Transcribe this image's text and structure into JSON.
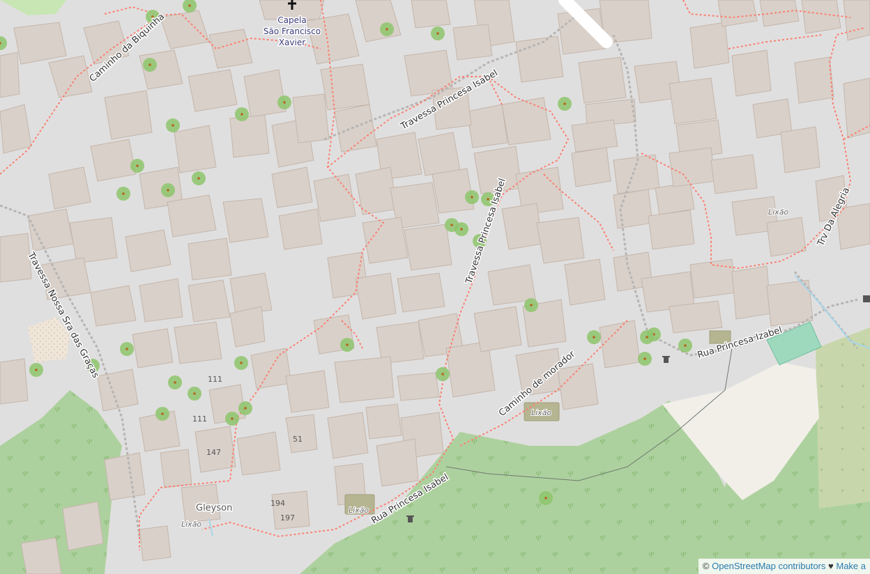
{
  "map": {
    "chapel": {
      "name_line1": "Capela",
      "name_line2": "São Francisco",
      "name_line3": "Xavier",
      "icon": "cross-icon"
    },
    "streets": {
      "caminho_biquinha": "Caminho da Biquinha",
      "travessa_princesa_isabel_top": "Travessa Princesa Isabel",
      "travessa_princesa_isabel_mid": "Travessa Princesa Isabel",
      "travessa_nossa_sra": "Travessa Nossa Sra das Graças",
      "caminho_morador": "Caminho de morador",
      "rua_princesa_isabel": "Rua Princesa Isabel",
      "rua_princesa_izabel": "Rua Princesa Izabel",
      "trv_da_alegria": "Trv Da Alegria"
    },
    "labels": {
      "lixao_1": "Lixão",
      "lixao_2": "Lixão",
      "lixao_3": "Lixão",
      "lixao_4": "Lixão",
      "gleyson": "Gleyson"
    },
    "house_numbers": {
      "n111a": "111",
      "n111b": "111",
      "n147": "147",
      "n51": "51",
      "n194": "194",
      "n197": "197"
    },
    "colors": {
      "background": "#e0dfdf",
      "building": "#d9d0c9",
      "building_outline": "#c4b6ab",
      "forest": "#add19e",
      "road_casing": "#fa8072",
      "footway": "#b7b5b3",
      "tree": "#8dc56c",
      "landfill": "#b6b592"
    }
  },
  "attribution": {
    "copyright_symbol": "©",
    "link_text": "OpenStreetMap contributors",
    "heart": "♥",
    "suffix": "Make a"
  }
}
